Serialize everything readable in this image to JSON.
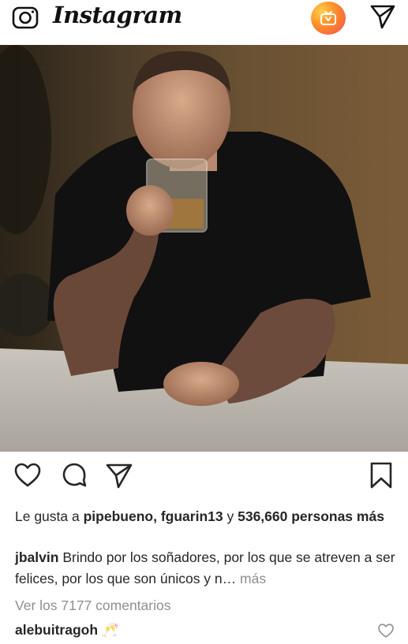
{
  "header": {
    "logo_text": "Instagram",
    "icons": [
      "camera-icon",
      "igtv-icon",
      "direct-send-icon"
    ],
    "igtv_gradient": [
      "#ffcf4a",
      "#ff8a2a",
      "#f24f4f"
    ]
  },
  "post": {
    "actions": [
      "heart-icon",
      "comment-icon",
      "share-icon",
      "bookmark-icon"
    ],
    "likes": {
      "prefix": "Le gusta a",
      "user1": "pipebueno",
      "separator": ",",
      "user2": "fguarin13",
      "connector": "y",
      "count_text": "536,660 personas más"
    },
    "caption": {
      "username": "jbalvin",
      "text": "Brindo por los soñadores, por los que se atreven a ser felices, por los que son únicos y n…",
      "more_label": "más"
    },
    "view_comments": "Ver los 7177 comentarios",
    "top_comment": {
      "username": "alebuitragoh",
      "text": "🥂"
    }
  },
  "colors": {
    "text": "#262626",
    "muted": "#8e8e8e"
  }
}
